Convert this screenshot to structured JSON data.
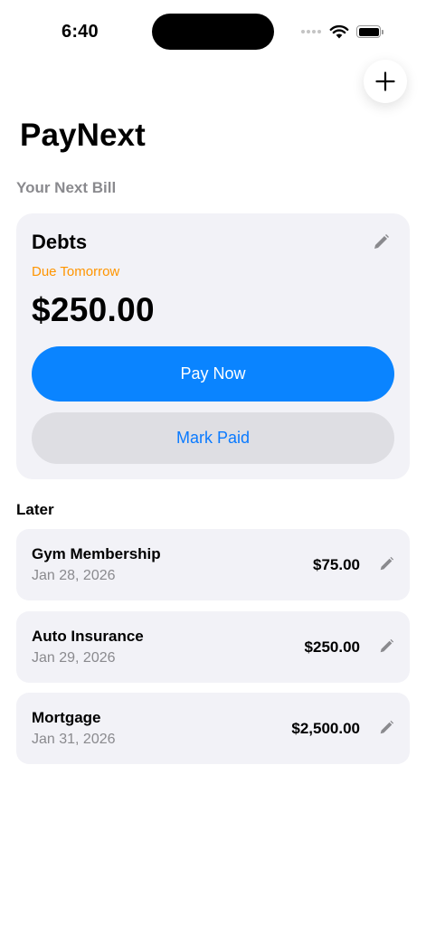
{
  "status_bar": {
    "time": "6:40"
  },
  "header": {
    "title": "PayNext",
    "add_icon": "plus-icon"
  },
  "next_bill": {
    "section_label": "Your Next Bill",
    "name": "Debts",
    "due_text": "Due Tomorrow",
    "amount": "$250.00",
    "pay_label": "Pay Now",
    "mark_paid_label": "Mark Paid",
    "accent_color": "#0a84ff",
    "due_color": "#ff9500"
  },
  "later": {
    "section_label": "Later",
    "items": [
      {
        "name": "Gym Membership",
        "date": "Jan 28, 2026",
        "amount": "$75.00"
      },
      {
        "name": "Auto Insurance",
        "date": "Jan 29, 2026",
        "amount": "$250.00"
      },
      {
        "name": "Mortgage",
        "date": "Jan 31, 2026",
        "amount": "$2,500.00"
      }
    ]
  }
}
